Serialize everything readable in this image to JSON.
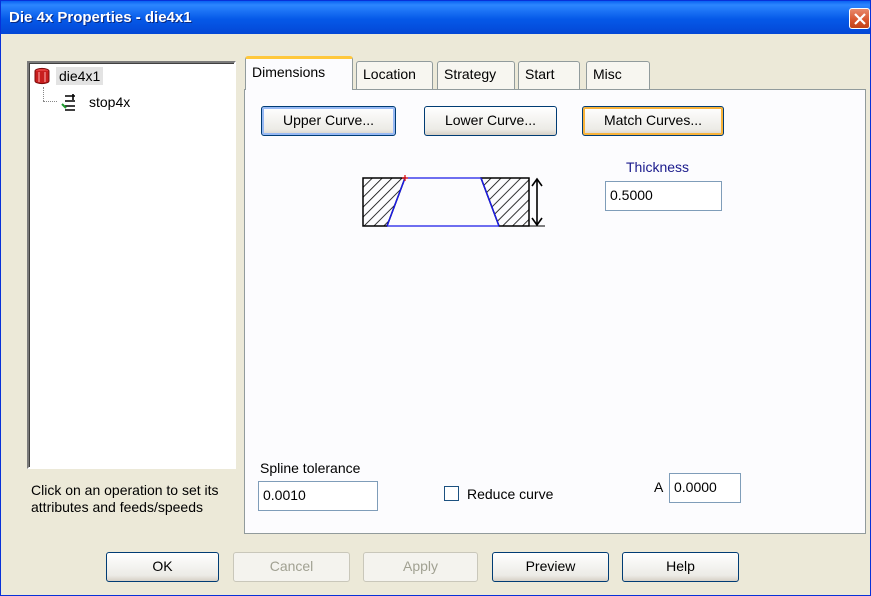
{
  "window": {
    "title": "Die 4x Properties - die4x1"
  },
  "tree": {
    "items": [
      {
        "label": "die4x1",
        "icon": "die-icon"
      },
      {
        "label": "stop4x",
        "icon": "stop-icon"
      }
    ]
  },
  "hint": {
    "text": "Click on an operation to set its attributes and feeds/speeds"
  },
  "tabs": [
    "Dimensions",
    "Location",
    "Strategy",
    "Start",
    "Misc"
  ],
  "dimensions": {
    "upper_curve_label": "Upper Curve...",
    "lower_curve_label": "Lower Curve...",
    "match_curves_label": "Match Curves...",
    "thickness_label": "Thickness",
    "thickness_value": "0.5000",
    "spline_tolerance_label": "Spline tolerance",
    "spline_tolerance_value": "0.0010",
    "reduce_curve_label": "Reduce curve",
    "reduce_curve_checked": false,
    "a_label": "A",
    "a_value": "0.0000"
  },
  "buttons": {
    "ok": "OK",
    "cancel": "Cancel",
    "apply": "Apply",
    "preview": "Preview",
    "help": "Help"
  },
  "colors": {
    "titlebar": "#0A62F2",
    "accent_tab": "#FFC83C",
    "thickness_label": "#1A1A8C"
  }
}
